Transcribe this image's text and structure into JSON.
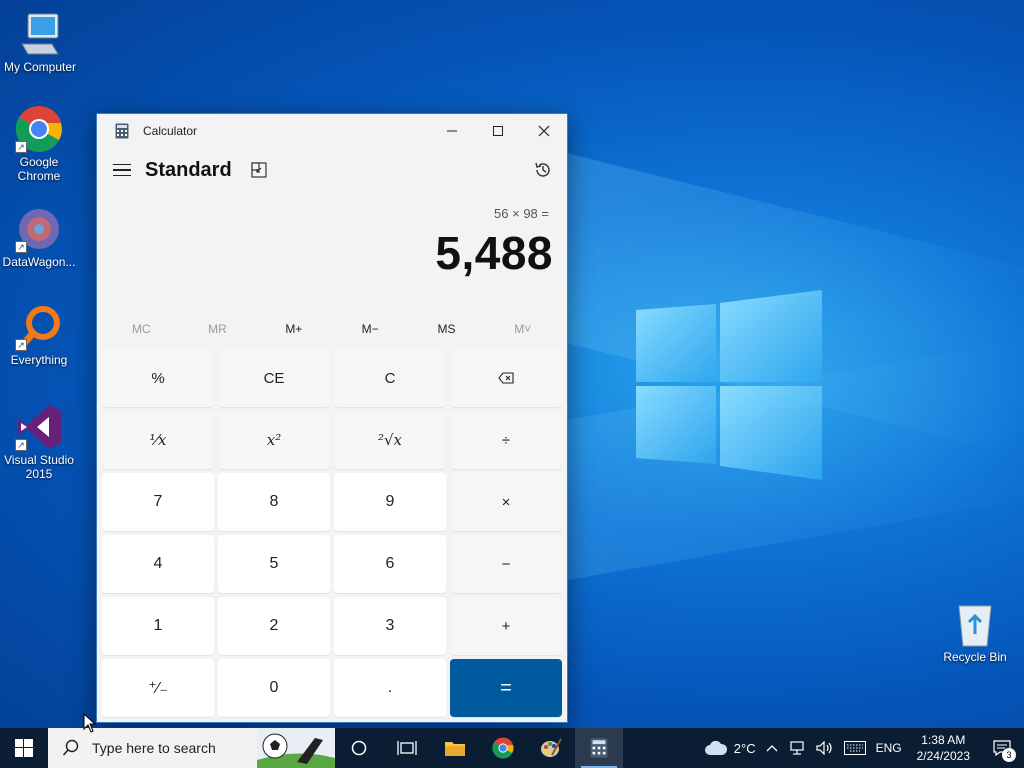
{
  "desktop": {
    "icons": [
      {
        "label": "My Computer"
      },
      {
        "label": "Google Chrome"
      },
      {
        "label": "DataWagon..."
      },
      {
        "label": "Everything"
      },
      {
        "label": "Visual Studio 2015"
      },
      {
        "label": "Recycle Bin"
      }
    ]
  },
  "calculator": {
    "window_title": "Calculator",
    "mode": "Standard",
    "expression": "56 × 98 =",
    "result": "5,488",
    "memory": [
      {
        "label": "MC",
        "enabled": false
      },
      {
        "label": "MR",
        "enabled": false
      },
      {
        "label": "M+",
        "enabled": true
      },
      {
        "label": "M−",
        "enabled": true
      },
      {
        "label": "MS",
        "enabled": true
      },
      {
        "label": "M˅",
        "enabled": false
      }
    ],
    "keys": {
      "percent": "%",
      "ce": "CE",
      "c": "C",
      "backspace": "⌫",
      "reciprocal": "¹⁄x",
      "square": "x²",
      "sqrt": "²√x",
      "divide": "÷",
      "seven": "7",
      "eight": "8",
      "nine": "9",
      "multiply": "×",
      "four": "4",
      "five": "5",
      "six": "6",
      "minus": "−",
      "one": "1",
      "two": "2",
      "three": "3",
      "plus": "+",
      "negate": "⁺∕₋",
      "zero": "0",
      "decimal": ".",
      "equals": "="
    },
    "accent_color": "#005a9e"
  },
  "taskbar": {
    "search_placeholder": "Type here to search",
    "weather": "2°C",
    "language": "ENG",
    "time": "1:38 AM",
    "date": "2/24/2023",
    "notification_count": "3"
  }
}
